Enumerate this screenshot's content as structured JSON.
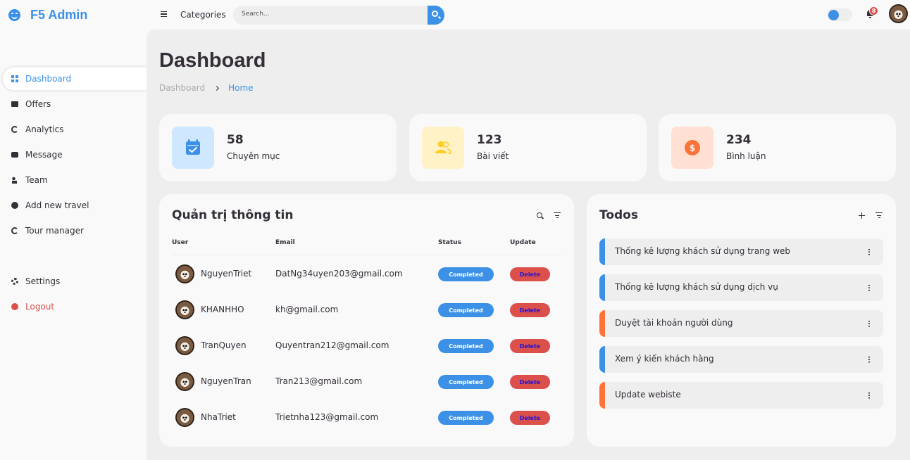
{
  "brand": {
    "name": "F5 Admin"
  },
  "sidebar": {
    "items": [
      {
        "label": "Dashboard",
        "icon": "dashboard-icon"
      },
      {
        "label": "Offers",
        "icon": "mail-icon"
      },
      {
        "label": "Analytics",
        "icon": "analytics-icon"
      },
      {
        "label": "Message",
        "icon": "message-icon"
      },
      {
        "label": "Team",
        "icon": "team-icon"
      },
      {
        "label": "Add new travel",
        "icon": "smile-icon"
      },
      {
        "label": "Tour manager",
        "icon": "tour-icon"
      }
    ],
    "bottom": [
      {
        "label": "Settings",
        "icon": "gear-icon"
      },
      {
        "label": "Logout",
        "icon": "logout-icon"
      }
    ]
  },
  "navbar": {
    "link": "Categories",
    "search_placeholder": "Search...",
    "notification_count": "8"
  },
  "page": {
    "title": "Dashboard",
    "breadcrumb": [
      "Dashboard",
      "Home"
    ]
  },
  "stats": [
    {
      "value": "58",
      "label": "Chuyên mục",
      "icon": "calendar-check-icon",
      "bg": "#cfe8ff",
      "color": "#3c91e6"
    },
    {
      "value": "123",
      "label": "Bài viết",
      "icon": "group-icon",
      "bg": "#fff2c6",
      "color": "#ffce26"
    },
    {
      "value": "234",
      "label": "Bình luận",
      "icon": "dollar-circle-icon",
      "bg": "#ffe0d3",
      "color": "#fd7238"
    }
  ],
  "users_table": {
    "title": "Quản trị thông tin",
    "headers": [
      "User",
      "Email",
      "Status",
      "Update"
    ],
    "rows": [
      {
        "user": "NguyenTriet",
        "email": "DatNg34uyen203@gmail.com",
        "status": "Completed",
        "action": "Delete"
      },
      {
        "user": "KHANHHO",
        "email": "kh@gmail.com",
        "status": "Completed",
        "action": "Delete"
      },
      {
        "user": "TranQuyen",
        "email": "Quyentran212@gmail.com",
        "status": "Completed",
        "action": "Delete"
      },
      {
        "user": "NguyenTran",
        "email": "Tran213@gmail.com",
        "status": "Completed",
        "action": "Delete"
      },
      {
        "user": "NhaTriet",
        "email": "Trietnha123@gmail.com",
        "status": "Completed",
        "action": "Delete"
      }
    ]
  },
  "todos": {
    "title": "Todos",
    "items": [
      {
        "text": "Thống kê lượng khách sử dụng trang web",
        "state": "completed"
      },
      {
        "text": "Thống kê lượng khách sử dụng dịch vụ",
        "state": "completed"
      },
      {
        "text": "Duyệt tài khoản người dùng",
        "state": "not-completed"
      },
      {
        "text": "Xem ý kiến khách hàng",
        "state": "completed"
      },
      {
        "text": "Update webiste",
        "state": "not-completed"
      }
    ]
  },
  "colors": {
    "accent": "#3c91e6",
    "danger": "#db504a",
    "orange": "#fd7238",
    "yellow": "#ffce26"
  }
}
